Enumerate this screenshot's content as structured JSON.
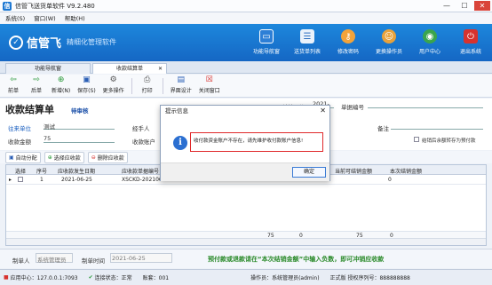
{
  "window": {
    "title": "信管飞送货单软件 V9.2.480",
    "minimize": "—",
    "maximize": "☐",
    "close": "✕"
  },
  "menu": [
    "系统(S)",
    "窗口(W)",
    "帮助(H)"
  ],
  "banner": {
    "brand": "信管飞",
    "slogan": "精细化管理软件"
  },
  "nav": [
    {
      "label": "功能导航窗",
      "icon": "monitor-icon",
      "color": "#2d7fd6"
    },
    {
      "label": "送货单列表",
      "icon": "list-icon",
      "color": "#4d8fd8"
    },
    {
      "label": "修改密码",
      "icon": "key-icon",
      "color": "#f2a33a"
    },
    {
      "label": "更换操作员",
      "icon": "user-icon",
      "color": "#e8a23c"
    },
    {
      "label": "用户中心",
      "icon": "globe-icon",
      "color": "#3aa54c"
    },
    {
      "label": "退出系统",
      "icon": "power-icon",
      "color": "#d7322e"
    }
  ],
  "tabs": [
    {
      "label": "功能导航窗"
    },
    {
      "label": "收款结算单",
      "close": "✕"
    }
  ],
  "toolbar": [
    "前单",
    "后单",
    "新增(N)",
    "保存(S)",
    "更多操作",
    "打印",
    "界面设计",
    "关闭窗口"
  ],
  "form": {
    "title": "收款结算单",
    "status": "待审核",
    "date_label": "结算日期",
    "date_value": "2021-06-25",
    "number_label": "单据编号",
    "customer_label": "往来单位",
    "customer_value": "测试",
    "handler_label": "经手人",
    "remark_label": "备注",
    "amount_label": "收款金额",
    "amount_value": "75",
    "account_label": "收款账户",
    "prepay_check": "结销后余额转存为预付款"
  },
  "actions": [
    "自动分配",
    "选择应收款",
    "删除应收款"
  ],
  "grid": {
    "headers": [
      "选择",
      "序号",
      "应收款发生日期",
      "应收款单据编号",
      "当前可结销金额",
      "本次结销金额"
    ],
    "rows": [
      {
        "select": "▸",
        "no": "1",
        "date": "2021-06-25",
        "code": "XSCKD-20210625-00",
        "current": "",
        "amount": "0"
      }
    ],
    "totals": [
      "75",
      "0",
      "75",
      "0"
    ]
  },
  "footer": {
    "maker_label": "制单人",
    "maker_value": "系统管理员",
    "maketime_label": "制单时间",
    "maketime_value": "2021-06-25",
    "notice": "预付款或退款请在“本次结销金额”中输入负数，即可冲销应收款"
  },
  "statusbar": [
    "应用中心：127.0.0.1:7093",
    "连接状态：正常",
    "账套：001",
    "操作员：系统管理员(admin)",
    "正式版 授权序列号：888888888"
  ],
  "dialog": {
    "title": "提示信息",
    "message": "收付款资金账户不存在，请先维护收付款账户信息!",
    "ok": "确定",
    "close": "✕"
  }
}
